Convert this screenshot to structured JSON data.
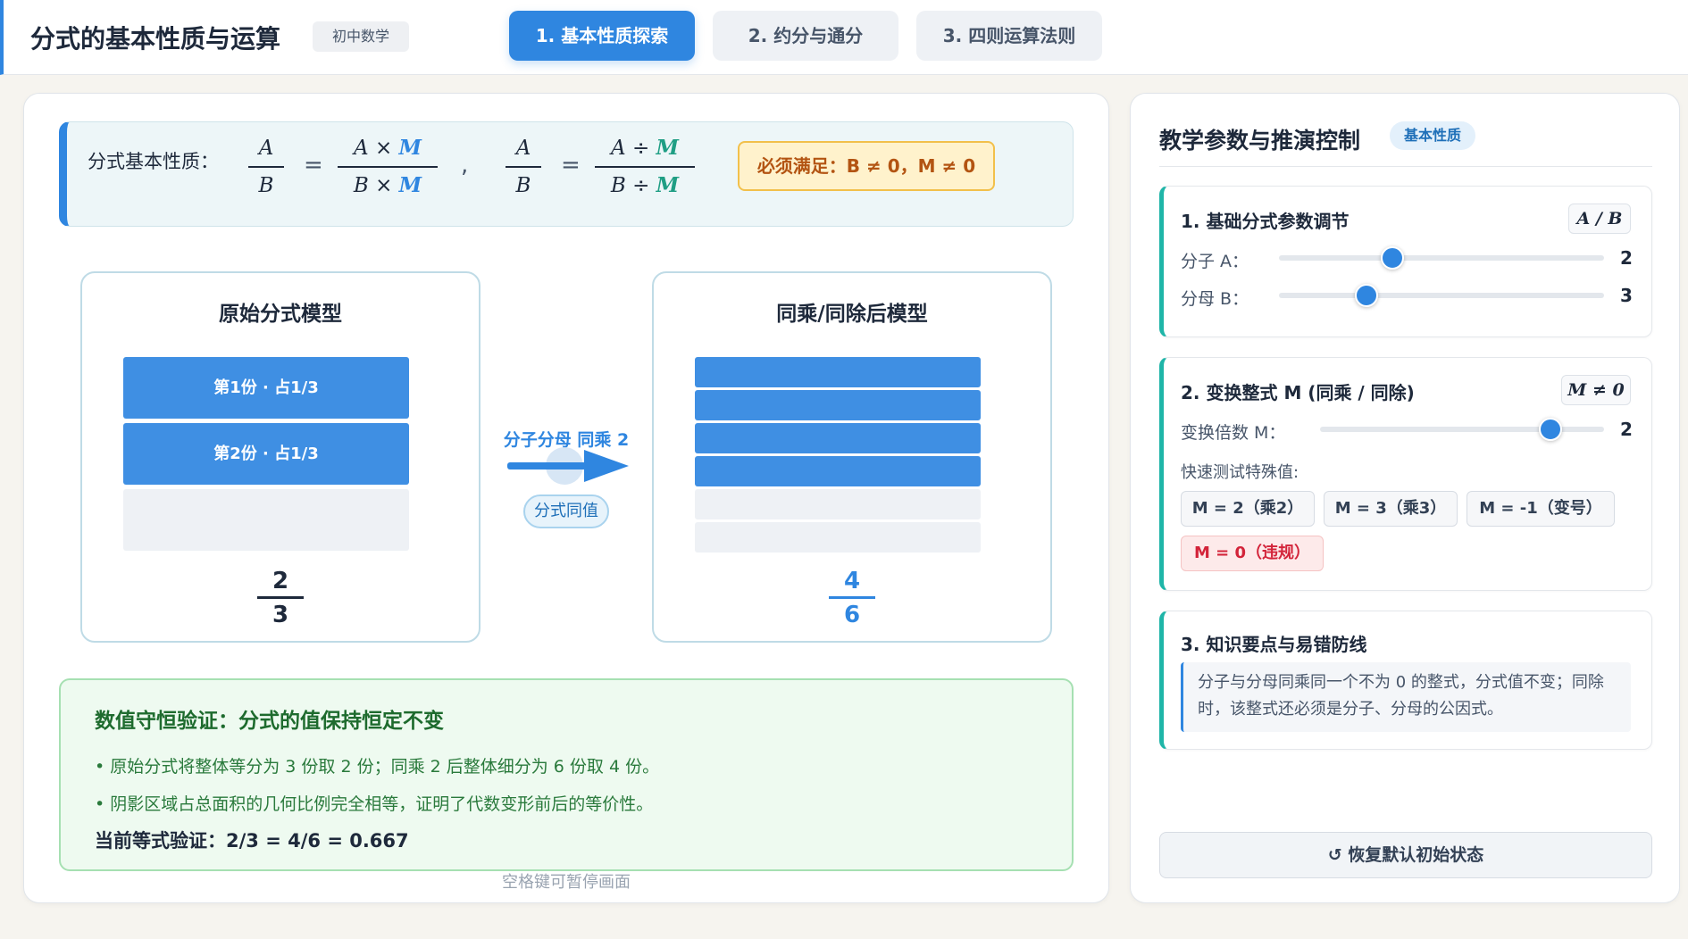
{
  "header": {
    "title": "分式的基本性质与运算",
    "grade": "初中数学",
    "tabs": [
      {
        "label": "1. 基本性质探索",
        "active": true
      },
      {
        "label": "2. 约分与通分",
        "active": false
      },
      {
        "label": "3. 四则运算法则",
        "active": false
      }
    ]
  },
  "formula": {
    "label": "分式基本性质：",
    "a": "A",
    "b": "B",
    "m": "M",
    "times": "×",
    "divide": "÷",
    "equals": "=",
    "comma": ",",
    "condition": "必须满足：B ≠ 0，M ≠ 0"
  },
  "original_model": {
    "title": "原始分式模型",
    "numerator": "2",
    "denominator": "3",
    "parts_filled": 2,
    "parts_total": 3,
    "block_labels": [
      "第1份 · 占1/3",
      "第2份 · 占1/3"
    ]
  },
  "transform": {
    "label": "分子分母 同乘 2",
    "badge": "分式同值"
  },
  "transformed_model": {
    "title": "同乘/同除后模型",
    "numerator": "4",
    "denominator": "6",
    "parts_filled": 4,
    "parts_total": 6
  },
  "verification": {
    "title": "数值守恒验证：分式的值保持恒定不变",
    "line1": "• 原始分式将整体等分为 3 份取 2 份；同乘 2 后整体细分为 6 份取 4 份。",
    "line2": "• 阴影区域占总面积的几何比例完全相等，证明了代数变形前后的等价性。",
    "equation": "当前等式验证：2/3 = 4/6 = 0.667"
  },
  "space_hint": "空格键可暂停画面",
  "side": {
    "title": "教学参数与推演控制",
    "badge": "基本性质",
    "section1": {
      "title": "1. 基础分式参数调节",
      "tag": "A / B",
      "numerator_label": "分子 A：",
      "numerator_value": "2",
      "numerator_fraction": 0.35,
      "denominator_label": "分母 B：",
      "denominator_value": "3",
      "denominator_fraction": 0.27
    },
    "section2": {
      "title": "2. 变换整式 M (同乘 / 同除)",
      "tag": "M ≠ 0",
      "multiplier_label": "变换倍数 M：",
      "multiplier_value": "2",
      "multiplier_fraction": 0.81,
      "quick_label": "快速测试特殊值:",
      "quick_buttons": [
        "M = 2（乘2）",
        "M = 3（乘3）",
        "M = -1（变号）",
        "M = 0（违规）"
      ]
    },
    "section3": {
      "title": "3. 知识要点与易错防线",
      "note": "分子与分母同乘同一个不为 0 的整式，分式值不变；同除时，该整式还必须是分子、分母的公因式。"
    },
    "reset_label": "↺ 恢复默认初始状态"
  },
  "colors": {
    "accent": "#2f86e0",
    "teal": "#1f9e84",
    "success": "#1e6b2e",
    "danger": "#d3243a",
    "warning": "#b35412"
  }
}
